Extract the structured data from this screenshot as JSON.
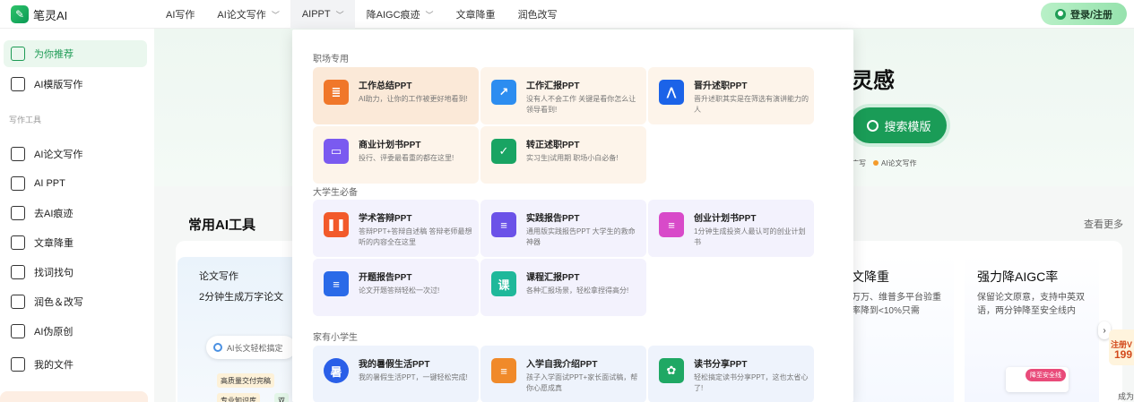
{
  "brand": {
    "logo_text": "笔灵AI"
  },
  "nav": {
    "items": [
      {
        "label": "AI写作",
        "chevron": false,
        "active": false
      },
      {
        "label": "AI论文写作",
        "chevron": true,
        "active": false
      },
      {
        "label": "AIPPT",
        "chevron": true,
        "active": true
      },
      {
        "label": "降AIGC痕迹",
        "chevron": true,
        "active": false
      },
      {
        "label": "文章降重",
        "chevron": false,
        "active": false
      },
      {
        "label": "润色改写",
        "chevron": false,
        "active": false
      }
    ],
    "login_label": "登录/注册"
  },
  "sidebar": {
    "items": [
      {
        "label": "为你推荐",
        "icon": "home-icon",
        "active": true
      },
      {
        "label": "AI模版写作",
        "icon": "template-icon"
      }
    ],
    "section_label": "写作工具",
    "tools": [
      {
        "label": "AI论文写作",
        "icon": "paper-icon"
      },
      {
        "label": "AI PPT",
        "icon": "ppt-icon"
      },
      {
        "label": "去AI痕迹",
        "icon": "erase-icon"
      },
      {
        "label": "文章降重",
        "icon": "reduce-icon"
      },
      {
        "label": "找词找句",
        "icon": "find-icon"
      },
      {
        "label": "润色＆改写",
        "icon": "polish-icon"
      },
      {
        "label": "AI伪原创",
        "icon": "rewrite-icon"
      },
      {
        "label": "我的文件",
        "icon": "file-icon"
      }
    ]
  },
  "banner": {
    "title": "灵感",
    "search_label": "搜索模版",
    "links": [
      "广写",
      "AI论文写作"
    ]
  },
  "tools": {
    "title": "常用AI工具",
    "see_more": "查看更多",
    "card1": {
      "title": "论文写作",
      "subtitle": "2分钟生成万字论文",
      "input_placeholder": "AI长文轻松搞定",
      "tags": [
        "高质量交付完稿",
        "专业知识库",
        "双"
      ]
    },
    "card2": {
      "title": "文降重",
      "desc": "万万、维普多平台验重率降到<10%只需"
    },
    "card3": {
      "title": "强力降AIGC率",
      "desc": "保留论文原意，支持中英双语，两分钟降至安全线内",
      "badge": "降至安全线"
    },
    "promo": {
      "line1": "注册V",
      "line2": "199",
      "line3": "成为"
    }
  },
  "dropdown": {
    "sections": [
      {
        "label": "职场专用",
        "color": "#f07a2e",
        "items": [
          {
            "title": "工作总结PPT",
            "desc": "AI助力，让你的工作被更好地看到!",
            "icon": "summary-icon",
            "icon_color": "#f0772a",
            "glyph": "≣"
          },
          {
            "title": "工作汇报PPT",
            "desc": "没有人不会工作 关键是看你怎么让领导看到!",
            "icon": "report-chart-icon",
            "icon_color": "#2c8df0",
            "glyph": "↗"
          },
          {
            "title": "晋升述职PPT",
            "desc": "晋升述职其实是在筛选有演讲能力的人",
            "icon": "presenter-icon",
            "icon_color": "#1b63e8",
            "glyph": "⋀"
          },
          {
            "title": "商业计划书PPT",
            "desc": "投行、评委最看重的都在这里!",
            "icon": "briefcase-icon",
            "icon_color": "#7a5af0",
            "glyph": "▭"
          },
          {
            "title": "转正述职PPT",
            "desc": "实习生|试用期 职场小白必备!",
            "icon": "checklist-icon",
            "icon_color": "#19a463",
            "glyph": "✓"
          }
        ]
      },
      {
        "label": "大学生必备",
        "color": "#7a5af0",
        "items": [
          {
            "title": "学术答辩PPT",
            "desc": "答辩PPT+答辩自述稿 答辩老师最想听的内容全在这里",
            "icon": "book-icon",
            "icon_color": "#f25a2a",
            "glyph": "❚❚"
          },
          {
            "title": "实践报告PPT",
            "desc": "通用版实践报告PPT 大学生的救命神器",
            "icon": "clipboard-icon",
            "icon_color": "#6b52e8",
            "glyph": "≡"
          },
          {
            "title": "创业计划书PPT",
            "desc": "1分钟生成投资人最认可的创业计划书",
            "icon": "plan-doc-icon",
            "icon_color": "#d84ac9",
            "glyph": "≡"
          },
          {
            "title": "开题报告PPT",
            "desc": "论文开题答辩轻松一次过!",
            "icon": "doc-search-icon",
            "icon_color": "#2a6ae8",
            "glyph": "≡"
          },
          {
            "title": "课程汇报PPT",
            "desc": "各种汇报场景，轻松拿捏得高分!",
            "icon": "course-icon",
            "icon_color": "#1fb89a",
            "glyph": "课"
          }
        ]
      },
      {
        "label": "家有小学生",
        "color": "#2c8df0",
        "items": [
          {
            "title": "我的暑假生活PPT",
            "desc": "我的暑假生活PPT，一键轻松完成!",
            "icon": "summer-icon",
            "icon_color": "#2a5fe8",
            "glyph": "暑"
          },
          {
            "title": "入学自我介绍PPT",
            "desc": "孩子入学面试PPT+家长面试稿，帮你心愿成真",
            "icon": "intro-icon",
            "icon_color": "#f08a2a",
            "glyph": "≡"
          },
          {
            "title": "读书分享PPT",
            "desc": "轻松搞定读书分享PPT，这也太省心了!",
            "icon": "reading-icon",
            "icon_color": "#1fa864",
            "glyph": "✿"
          }
        ]
      }
    ]
  }
}
